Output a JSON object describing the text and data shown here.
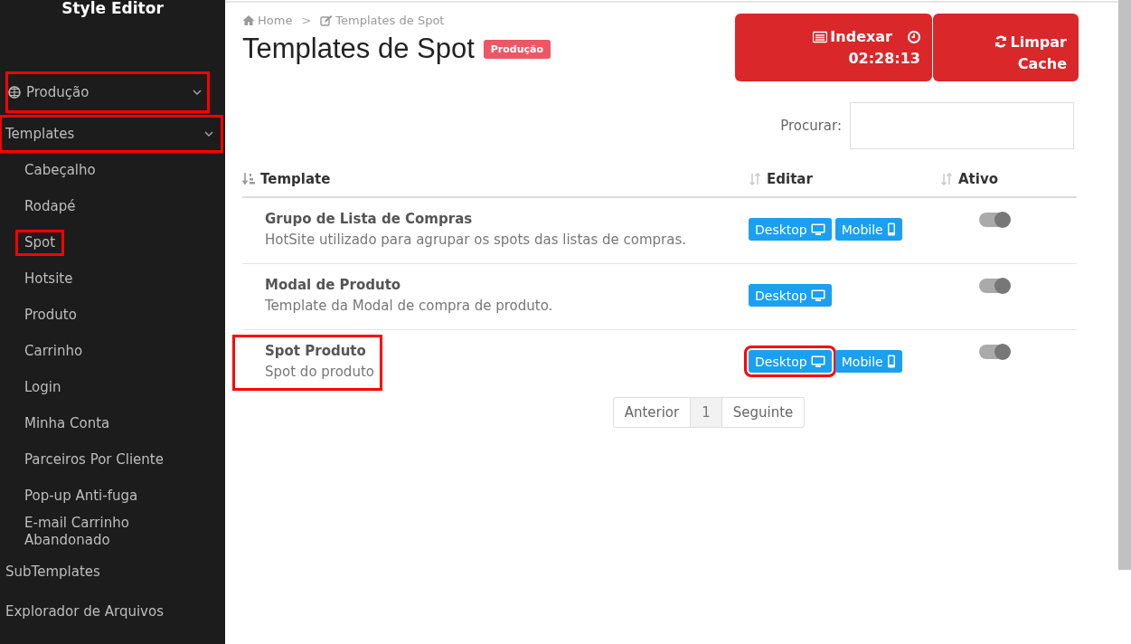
{
  "sidebar": {
    "title": "Style Editor",
    "environment": {
      "label": "Produção",
      "highlighted": true
    },
    "items": [
      {
        "label": "Templates",
        "expanded": true,
        "highlighted": true,
        "children": [
          {
            "label": "Cabeçalho",
            "highlighted": false
          },
          {
            "label": "Rodapé",
            "highlighted": false
          },
          {
            "label": "Spot",
            "highlighted": true
          },
          {
            "label": "Hotsite",
            "highlighted": false
          },
          {
            "label": "Produto",
            "highlighted": false
          },
          {
            "label": "Carrinho",
            "highlighted": false
          },
          {
            "label": "Login",
            "highlighted": false
          },
          {
            "label": "Minha Conta",
            "highlighted": false
          },
          {
            "label": "Parceiros Por Cliente",
            "highlighted": false
          },
          {
            "label": "Pop-up Anti-fuga",
            "highlighted": false
          },
          {
            "label": "E-mail Carrinho Abandonado",
            "highlighted": false
          }
        ]
      },
      {
        "label": "SubTemplates",
        "highlighted": false
      },
      {
        "label": "Explorador de Arquivos",
        "highlighted": false
      }
    ]
  },
  "breadcrumb": [
    {
      "label": "Home",
      "kind": "home"
    },
    {
      "label": "Templates de Spot",
      "kind": "edit"
    }
  ],
  "breadcrumb_separator": ">",
  "page_title": "Templates de Spot",
  "environment_badge": "Produção",
  "actions": [
    {
      "kind": "index",
      "label": "Indexar",
      "timer": "02:28:13"
    },
    {
      "kind": "cache",
      "label": "Limpar Cache"
    }
  ],
  "search": {
    "label": "Procurar:"
  },
  "table": {
    "columns": [
      {
        "label": "Template",
        "sorted": true
      },
      {
        "label": "Editar",
        "sorted": false
      },
      {
        "label": "Ativo",
        "sorted": false
      }
    ],
    "rows": [
      {
        "name": "Grupo de Lista de Compras",
        "description": "HotSite utilizado para agrupar os spots das listas de compras.",
        "highlighted": false,
        "buttons": [
          {
            "label": "Desktop",
            "kind": "desktop",
            "highlighted": false
          },
          {
            "label": "Mobile",
            "kind": "mobile",
            "highlighted": false
          }
        ],
        "active": true
      },
      {
        "name": "Modal de Produto",
        "description": "Template da Modal de compra de produto.",
        "highlighted": false,
        "buttons": [
          {
            "label": "Desktop",
            "kind": "desktop",
            "highlighted": false
          }
        ],
        "active": true
      },
      {
        "name": "Spot Produto",
        "description": "Spot do produto",
        "highlighted": true,
        "buttons": [
          {
            "label": "Desktop",
            "kind": "desktop",
            "highlighted": true
          },
          {
            "label": "Mobile",
            "kind": "mobile",
            "highlighted": false
          }
        ],
        "active": true
      }
    ]
  },
  "pagination": [
    {
      "label": "Anterior",
      "selected": false
    },
    {
      "label": "1",
      "selected": true
    },
    {
      "label": "Seguinte",
      "selected": false
    }
  ]
}
